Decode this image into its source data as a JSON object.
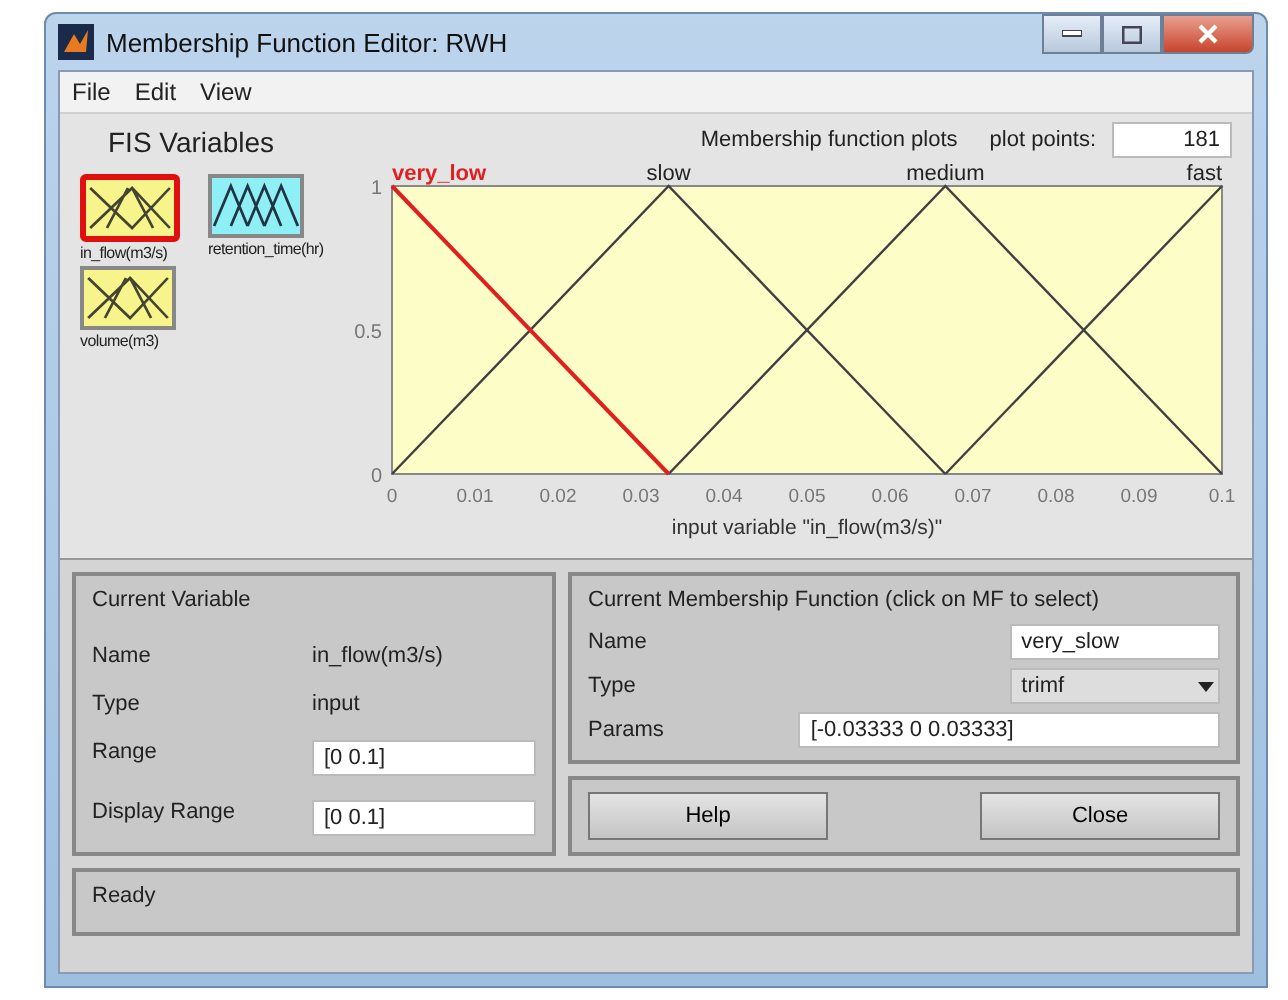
{
  "window": {
    "title": "Membership Function Editor: RWH"
  },
  "menu": [
    "File",
    "Edit",
    "View"
  ],
  "fis_variables": {
    "title": "FIS Variables",
    "items": [
      {
        "label": "in_flow(m3/s)",
        "kind": "input",
        "selected": true
      },
      {
        "label": "retention_time(hr)",
        "kind": "output",
        "selected": false
      },
      {
        "label": "volume(m3)",
        "kind": "input",
        "selected": false
      }
    ]
  },
  "plot_points": {
    "label": "plot points:",
    "value": "181"
  },
  "plot": {
    "chart_data": {
      "type": "line",
      "title": "Membership function plots",
      "xlabel": "input variable \"in_flow(m3/s)\"",
      "x": [
        0,
        0.03333,
        0.06667,
        0.1
      ],
      "series": [
        {
          "name": "very_low",
          "color": "#e02020",
          "values": [
            1,
            0,
            null,
            null
          ]
        },
        {
          "name": "slow",
          "color": "#404040",
          "values": [
            0,
            1,
            0,
            null
          ]
        },
        {
          "name": "medium",
          "color": "#404040",
          "values": [
            null,
            0,
            1,
            0
          ]
        },
        {
          "name": "fast",
          "color": "#404040",
          "values": [
            null,
            null,
            0,
            1
          ]
        }
      ],
      "xlim": [
        0,
        0.1
      ],
      "ylim": [
        0,
        1
      ],
      "xticks": [
        0,
        0.01,
        0.02,
        0.03,
        0.04,
        0.05,
        0.06,
        0.07,
        0.08,
        0.09,
        0.1
      ],
      "yticks": [
        0,
        0.5,
        1
      ]
    }
  },
  "current_variable": {
    "title": "Current Variable",
    "name_label": "Name",
    "name": "in_flow(m3/s)",
    "type_label": "Type",
    "type": "input",
    "range_label": "Range",
    "range": "[0 0.1]",
    "display_range_label": "Display Range",
    "display_range": "[0 0.1]"
  },
  "current_mf": {
    "title": "Current Membership Function (click on MF to select)",
    "name_label": "Name",
    "name": "very_slow",
    "type_label": "Type",
    "type": "trimf",
    "params_label": "Params",
    "params": "[-0.03333 0 0.03333]"
  },
  "buttons": [
    "Help",
    "Close"
  ],
  "status": "Ready"
}
